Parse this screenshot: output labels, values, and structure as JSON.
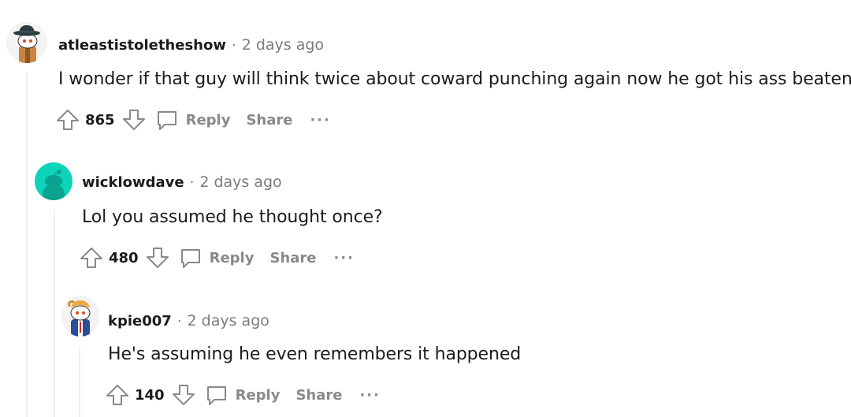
{
  "comments": [
    {
      "author": "atleastistoletheshow",
      "separator": "·",
      "time": "2 days ago",
      "body": "I wonder if that guy will think twice about coward punching again now he got his ass beaten",
      "score": "865",
      "reply_label": "Reply",
      "share_label": "Share",
      "more_label": "···",
      "avatar_icon": "snoo-detective-avatar"
    },
    {
      "author": "wicklowdave",
      "separator": "·",
      "time": "2 days ago",
      "body": "Lol you assumed he thought once?",
      "score": "480",
      "reply_label": "Reply",
      "share_label": "Share",
      "more_label": "···",
      "avatar_icon": "default-snoo-avatar"
    },
    {
      "author": "kpie007",
      "separator": "·",
      "time": "2 days ago",
      "body": "He's assuming he even remembers it happened",
      "score": "140",
      "reply_label": "Reply",
      "share_label": "Share",
      "more_label": "···",
      "avatar_icon": "snoo-blue-jacket-avatar"
    }
  ],
  "colors": {
    "text": "#1c1c1c",
    "muted": "#7c7c7c",
    "action": "#878a8c",
    "thread_line": "#edeff1",
    "default_avatar": "#0dd3bb"
  }
}
